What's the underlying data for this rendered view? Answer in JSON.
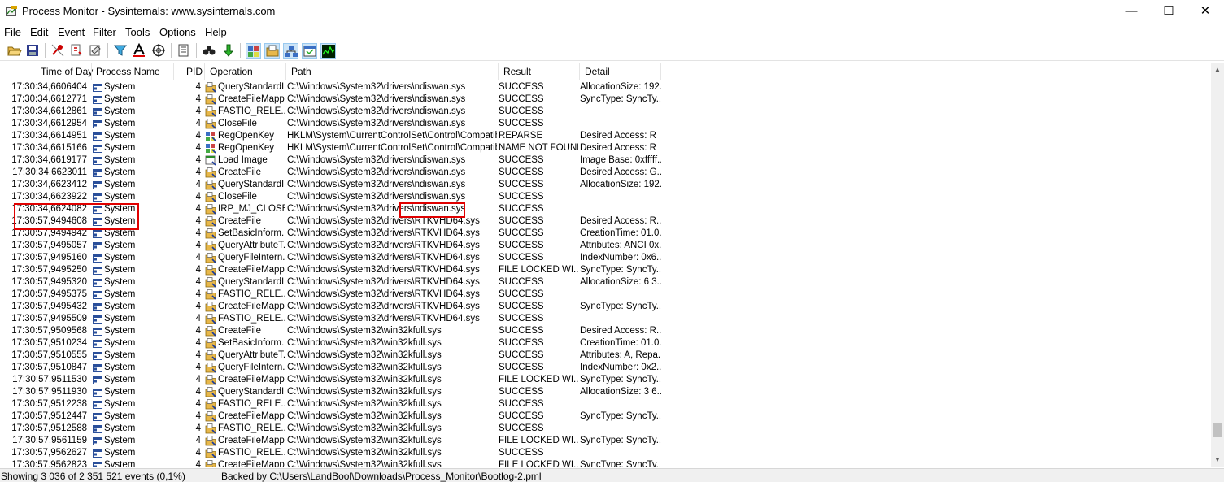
{
  "window": {
    "title": "Process Monitor - Sysinternals: www.sysinternals.com",
    "minimize_glyph": "—",
    "maximize_glyph": "☐",
    "close_glyph": "✕"
  },
  "menu": [
    "File",
    "Edit",
    "Event",
    "Filter",
    "Tools",
    "Options",
    "Help"
  ],
  "toolbar_icons": [
    "open-icon",
    "save-icon",
    "capture-icon",
    "autoscroll-icon",
    "clear-icon",
    "filter-icon",
    "highlight-icon",
    "target-icon",
    "tree-icon",
    "find-icon",
    "jump-icon",
    "registry-activity-icon",
    "file-activity-icon",
    "network-activity-icon",
    "process-activity-icon",
    "profiling-icon"
  ],
  "columns": {
    "time": "Time of Day",
    "process": "Process Name",
    "pid": "PID",
    "operation": "Operation",
    "path": "Path",
    "result": "Result",
    "detail": "Detail"
  },
  "rows": [
    {
      "time": "17:30:34,6606404",
      "process": "System",
      "pid": "4",
      "op": "QueryStandardI...",
      "optype": "file",
      "path": "C:\\Windows\\System32\\drivers\\ndiswan.sys",
      "result": "SUCCESS",
      "detail": "AllocationSize: 192..."
    },
    {
      "time": "17:30:34,6612771",
      "process": "System",
      "pid": "4",
      "op": "CreateFileMapp",
      "optype": "file",
      "path": "C:\\Windows\\System32\\drivers\\ndiswan.sys",
      "result": "SUCCESS",
      "detail": "SyncType: SyncTy..."
    },
    {
      "time": "17:30:34,6612861",
      "process": "System",
      "pid": "4",
      "op": "FASTIO_RELE...",
      "optype": "file",
      "path": "C:\\Windows\\System32\\drivers\\ndiswan.sys",
      "result": "SUCCESS",
      "detail": ""
    },
    {
      "time": "17:30:34,6612954",
      "process": "System",
      "pid": "4",
      "op": "CloseFile",
      "optype": "file",
      "path": "C:\\Windows\\System32\\drivers\\ndiswan.sys",
      "result": "SUCCESS",
      "detail": ""
    },
    {
      "time": "17:30:34,6614951",
      "process": "System",
      "pid": "4",
      "op": "RegOpenKey",
      "optype": "reg",
      "path": "HKLM\\System\\CurrentControlSet\\Control\\Compatibili...",
      "result": "REPARSE",
      "detail": "Desired Access: R"
    },
    {
      "time": "17:30:34,6615166",
      "process": "System",
      "pid": "4",
      "op": "RegOpenKey",
      "optype": "reg",
      "path": "HKLM\\System\\CurrentControlSet\\Control\\Compatibili...",
      "result": "NAME NOT FOUND",
      "detail": "Desired Access: R"
    },
    {
      "time": "17:30:34,6619177",
      "process": "System",
      "pid": "4",
      "op": "Load Image",
      "optype": "proc",
      "path": "C:\\Windows\\System32\\drivers\\ndiswan.sys",
      "result": "SUCCESS",
      "detail": "Image Base: 0xfffff..."
    },
    {
      "time": "17:30:34,6623011",
      "process": "System",
      "pid": "4",
      "op": "CreateFile",
      "optype": "file",
      "path": "C:\\Windows\\System32\\drivers\\ndiswan.sys",
      "result": "SUCCESS",
      "detail": "Desired Access: G..."
    },
    {
      "time": "17:30:34,6623412",
      "process": "System",
      "pid": "4",
      "op": "QueryStandardI...",
      "optype": "file",
      "path": "C:\\Windows\\System32\\drivers\\ndiswan.sys",
      "result": "SUCCESS",
      "detail": "AllocationSize: 192..."
    },
    {
      "time": "17:30:34,6623922",
      "process": "System",
      "pid": "4",
      "op": "CloseFile",
      "optype": "file",
      "path": "C:\\Windows\\System32\\drivers\\ndiswan.sys",
      "result": "SUCCESS",
      "detail": ""
    },
    {
      "time": "17:30:34,6624082",
      "process": "System",
      "pid": "4",
      "op": "IRP_MJ_CLOSE",
      "optype": "file",
      "path": "C:\\Windows\\System32\\drivers\\ndiswan.sys",
      "result": "SUCCESS",
      "detail": ""
    },
    {
      "time": "17:30:57,9494608",
      "process": "System",
      "pid": "4",
      "op": "CreateFile",
      "optype": "file",
      "path": "C:\\Windows\\System32\\drivers\\RTKVHD64.sys",
      "result": "SUCCESS",
      "detail": "Desired Access: R..."
    },
    {
      "time": "17:30:57,9494942",
      "process": "System",
      "pid": "4",
      "op": "SetBasicInform...",
      "optype": "file",
      "path": "C:\\Windows\\System32\\drivers\\RTKVHD64.sys",
      "result": "SUCCESS",
      "detail": "CreationTime: 01.0..."
    },
    {
      "time": "17:30:57,9495057",
      "process": "System",
      "pid": "4",
      "op": "QueryAttributeT...",
      "optype": "file",
      "path": "C:\\Windows\\System32\\drivers\\RTKVHD64.sys",
      "result": "SUCCESS",
      "detail": "Attributes: ANCI 0x..."
    },
    {
      "time": "17:30:57,9495160",
      "process": "System",
      "pid": "4",
      "op": "QueryFileIntern...",
      "optype": "file",
      "path": "C:\\Windows\\System32\\drivers\\RTKVHD64.sys",
      "result": "SUCCESS",
      "detail": "IndexNumber: 0x6..."
    },
    {
      "time": "17:30:57,9495250",
      "process": "System",
      "pid": "4",
      "op": "CreateFileMapp",
      "optype": "file",
      "path": "C:\\Windows\\System32\\drivers\\RTKVHD64.sys",
      "result": "FILE LOCKED WI...",
      "detail": "SyncType: SyncTy..."
    },
    {
      "time": "17:30:57,9495320",
      "process": "System",
      "pid": "4",
      "op": "QueryStandardI...",
      "optype": "file",
      "path": "C:\\Windows\\System32\\drivers\\RTKVHD64.sys",
      "result": "SUCCESS",
      "detail": "AllocationSize: 6 3..."
    },
    {
      "time": "17:30:57,9495375",
      "process": "System",
      "pid": "4",
      "op": "FASTIO_RELE...",
      "optype": "file",
      "path": "C:\\Windows\\System32\\drivers\\RTKVHD64.sys",
      "result": "SUCCESS",
      "detail": ""
    },
    {
      "time": "17:30:57,9495432",
      "process": "System",
      "pid": "4",
      "op": "CreateFileMapp",
      "optype": "file",
      "path": "C:\\Windows\\System32\\drivers\\RTKVHD64.sys",
      "result": "SUCCESS",
      "detail": "SyncType: SyncTy..."
    },
    {
      "time": "17:30:57,9495509",
      "process": "System",
      "pid": "4",
      "op": "FASTIO_RELE...",
      "optype": "file",
      "path": "C:\\Windows\\System32\\drivers\\RTKVHD64.sys",
      "result": "SUCCESS",
      "detail": ""
    },
    {
      "time": "17:30:57,9509568",
      "process": "System",
      "pid": "4",
      "op": "CreateFile",
      "optype": "file",
      "path": "C:\\Windows\\System32\\win32kfull.sys",
      "result": "SUCCESS",
      "detail": "Desired Access: R..."
    },
    {
      "time": "17:30:57,9510234",
      "process": "System",
      "pid": "4",
      "op": "SetBasicInform...",
      "optype": "file",
      "path": "C:\\Windows\\System32\\win32kfull.sys",
      "result": "SUCCESS",
      "detail": "CreationTime: 01.0..."
    },
    {
      "time": "17:30:57,9510555",
      "process": "System",
      "pid": "4",
      "op": "QueryAttributeT...",
      "optype": "file",
      "path": "C:\\Windows\\System32\\win32kfull.sys",
      "result": "SUCCESS",
      "detail": "Attributes: A, Repa..."
    },
    {
      "time": "17:30:57,9510847",
      "process": "System",
      "pid": "4",
      "op": "QueryFileIntern...",
      "optype": "file",
      "path": "C:\\Windows\\System32\\win32kfull.sys",
      "result": "SUCCESS",
      "detail": "IndexNumber: 0x2..."
    },
    {
      "time": "17:30:57,9511530",
      "process": "System",
      "pid": "4",
      "op": "CreateFileMapp",
      "optype": "file",
      "path": "C:\\Windows\\System32\\win32kfull.sys",
      "result": "FILE LOCKED WI...",
      "detail": "SyncType: SyncTy..."
    },
    {
      "time": "17:30:57,9511930",
      "process": "System",
      "pid": "4",
      "op": "QueryStandardI...",
      "optype": "file",
      "path": "C:\\Windows\\System32\\win32kfull.sys",
      "result": "SUCCESS",
      "detail": "AllocationSize: 3 6..."
    },
    {
      "time": "17:30:57,9512238",
      "process": "System",
      "pid": "4",
      "op": "FASTIO_RELE...",
      "optype": "file",
      "path": "C:\\Windows\\System32\\win32kfull.sys",
      "result": "SUCCESS",
      "detail": ""
    },
    {
      "time": "17:30:57,9512447",
      "process": "System",
      "pid": "4",
      "op": "CreateFileMapp",
      "optype": "file",
      "path": "C:\\Windows\\System32\\win32kfull.sys",
      "result": "SUCCESS",
      "detail": "SyncType: SyncTy..."
    },
    {
      "time": "17:30:57,9512588",
      "process": "System",
      "pid": "4",
      "op": "FASTIO_RELE...",
      "optype": "file",
      "path": "C:\\Windows\\System32\\win32kfull.sys",
      "result": "SUCCESS",
      "detail": ""
    },
    {
      "time": "17:30:57,9561159",
      "process": "System",
      "pid": "4",
      "op": "CreateFileMapp",
      "optype": "file",
      "path": "C:\\Windows\\System32\\win32kfull.sys",
      "result": "FILE LOCKED WI...",
      "detail": "SyncType: SyncTy..."
    },
    {
      "time": "17:30:57,9562627",
      "process": "System",
      "pid": "4",
      "op": "FASTIO_RELE...",
      "optype": "file",
      "path": "C:\\Windows\\System32\\win32kfull.sys",
      "result": "SUCCESS",
      "detail": ""
    },
    {
      "time": "17:30:57,9562823",
      "process": "System",
      "pid": "4",
      "op": "CreateFileMapp",
      "optype": "file",
      "path": "C:\\Windows\\System32\\win32kfull.sys",
      "result": "FILE LOCKED WI...",
      "detail": "SyncType: SyncTy..."
    }
  ],
  "status": {
    "events": "Showing 3 036 of 2 351 521 events (0,1%)",
    "backing": "Backed by C:\\Users\\LandBool\\Downloads\\Process_Monitor\\Bootlog-2.pml"
  },
  "colors": {
    "highlight_box": "#e00000",
    "pressed_button": "#cce4f7"
  }
}
